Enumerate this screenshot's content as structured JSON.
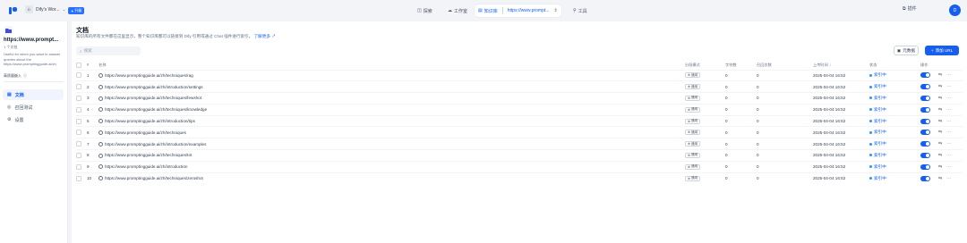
{
  "topbar": {
    "workspace_initial": "D",
    "workspace_name": "Dify's Wor...",
    "upgrade_label": "升级",
    "nav_explore": "探索",
    "nav_studio": "工作室",
    "nav_knowledge": "知识库",
    "nav_knowledge_current": "https://www.prompt...",
    "nav_tools": "工具",
    "help_label": "插件",
    "avatar_initial": "D"
  },
  "sidebar": {
    "dataset_name": "https://www.prompt...",
    "dataset_type": "1 个文档",
    "dataset_desc": "Useful for when you want to answer queries about the https://www.promptingguide.ai/zh",
    "embedding_label": "高质量嵌入",
    "items": [
      {
        "label": "文档",
        "icon": "document-icon"
      },
      {
        "label": "召回测试",
        "icon": "target-icon"
      },
      {
        "label": "设置",
        "icon": "gear-icon"
      }
    ]
  },
  "main": {
    "title": "文档",
    "description": "知识库的所有文件都在这里显示，整个知识库都可以链接到 Dify 引用或通过 Chat 插件进行索引。",
    "learn_more": "了解更多",
    "search_placeholder": "搜索",
    "metadata_button": "元数据",
    "add_button": "添加 URL",
    "columns": {
      "num": "#",
      "name": "名称",
      "mode": "分段模式",
      "chars": "字符数",
      "recall": "召回次数",
      "upload_time": "上传时间",
      "status": "状态",
      "actions": "操作"
    },
    "rows": [
      {
        "num": "1",
        "name": "https://www.promptingguide.ai/zh/techniques/rag",
        "mode": "通用",
        "chars": "0",
        "recall": "0",
        "time": "2025-04-04 16:52",
        "status": "索引中"
      },
      {
        "num": "2",
        "name": "https://www.promptingguide.ai/zh/introduction/settings",
        "mode": "通用",
        "chars": "0",
        "recall": "0",
        "time": "2025-04-04 16:52",
        "status": "索引中"
      },
      {
        "num": "3",
        "name": "https://www.promptingguide.ai/zh/techniques/fewshot",
        "mode": "通用",
        "chars": "0",
        "recall": "0",
        "time": "2025-04-04 16:52",
        "status": "索引中"
      },
      {
        "num": "4",
        "name": "https://www.promptingguide.ai/zh/techniques/knowledge",
        "mode": "通用",
        "chars": "0",
        "recall": "0",
        "time": "2025-04-04 16:52",
        "status": "索引中"
      },
      {
        "num": "5",
        "name": "https://www.promptingguide.ai/zh/introduction/tips",
        "mode": "通用",
        "chars": "0",
        "recall": "0",
        "time": "2025-04-04 16:52",
        "status": "索引中"
      },
      {
        "num": "6",
        "name": "https://www.promptingguide.ai/zh/techniques",
        "mode": "通用",
        "chars": "0",
        "recall": "0",
        "time": "2025-04-04 16:52",
        "status": "索引中"
      },
      {
        "num": "7",
        "name": "https://www.promptingguide.ai/zh/introduction/examples",
        "mode": "通用",
        "chars": "0",
        "recall": "0",
        "time": "2025-04-04 16:52",
        "status": "索引中"
      },
      {
        "num": "8",
        "name": "https://www.promptingguide.ai/zh/techniques/tot",
        "mode": "通用",
        "chars": "0",
        "recall": "0",
        "time": "2025-04-04 16:52",
        "status": "索引中"
      },
      {
        "num": "9",
        "name": "https://www.promptingguide.ai/zh/introduction",
        "mode": "通用",
        "chars": "0",
        "recall": "0",
        "time": "2025-04-04 16:52",
        "status": "索引中"
      },
      {
        "num": "10",
        "name": "https://www.promptingguide.ai/zh/techniques/zeroshot",
        "mode": "通用",
        "chars": "0",
        "recall": "0",
        "time": "2025-04-04 16:52",
        "status": "索引中"
      }
    ]
  },
  "colors": {
    "accent": "#155eef",
    "status": "#2e90fa"
  }
}
